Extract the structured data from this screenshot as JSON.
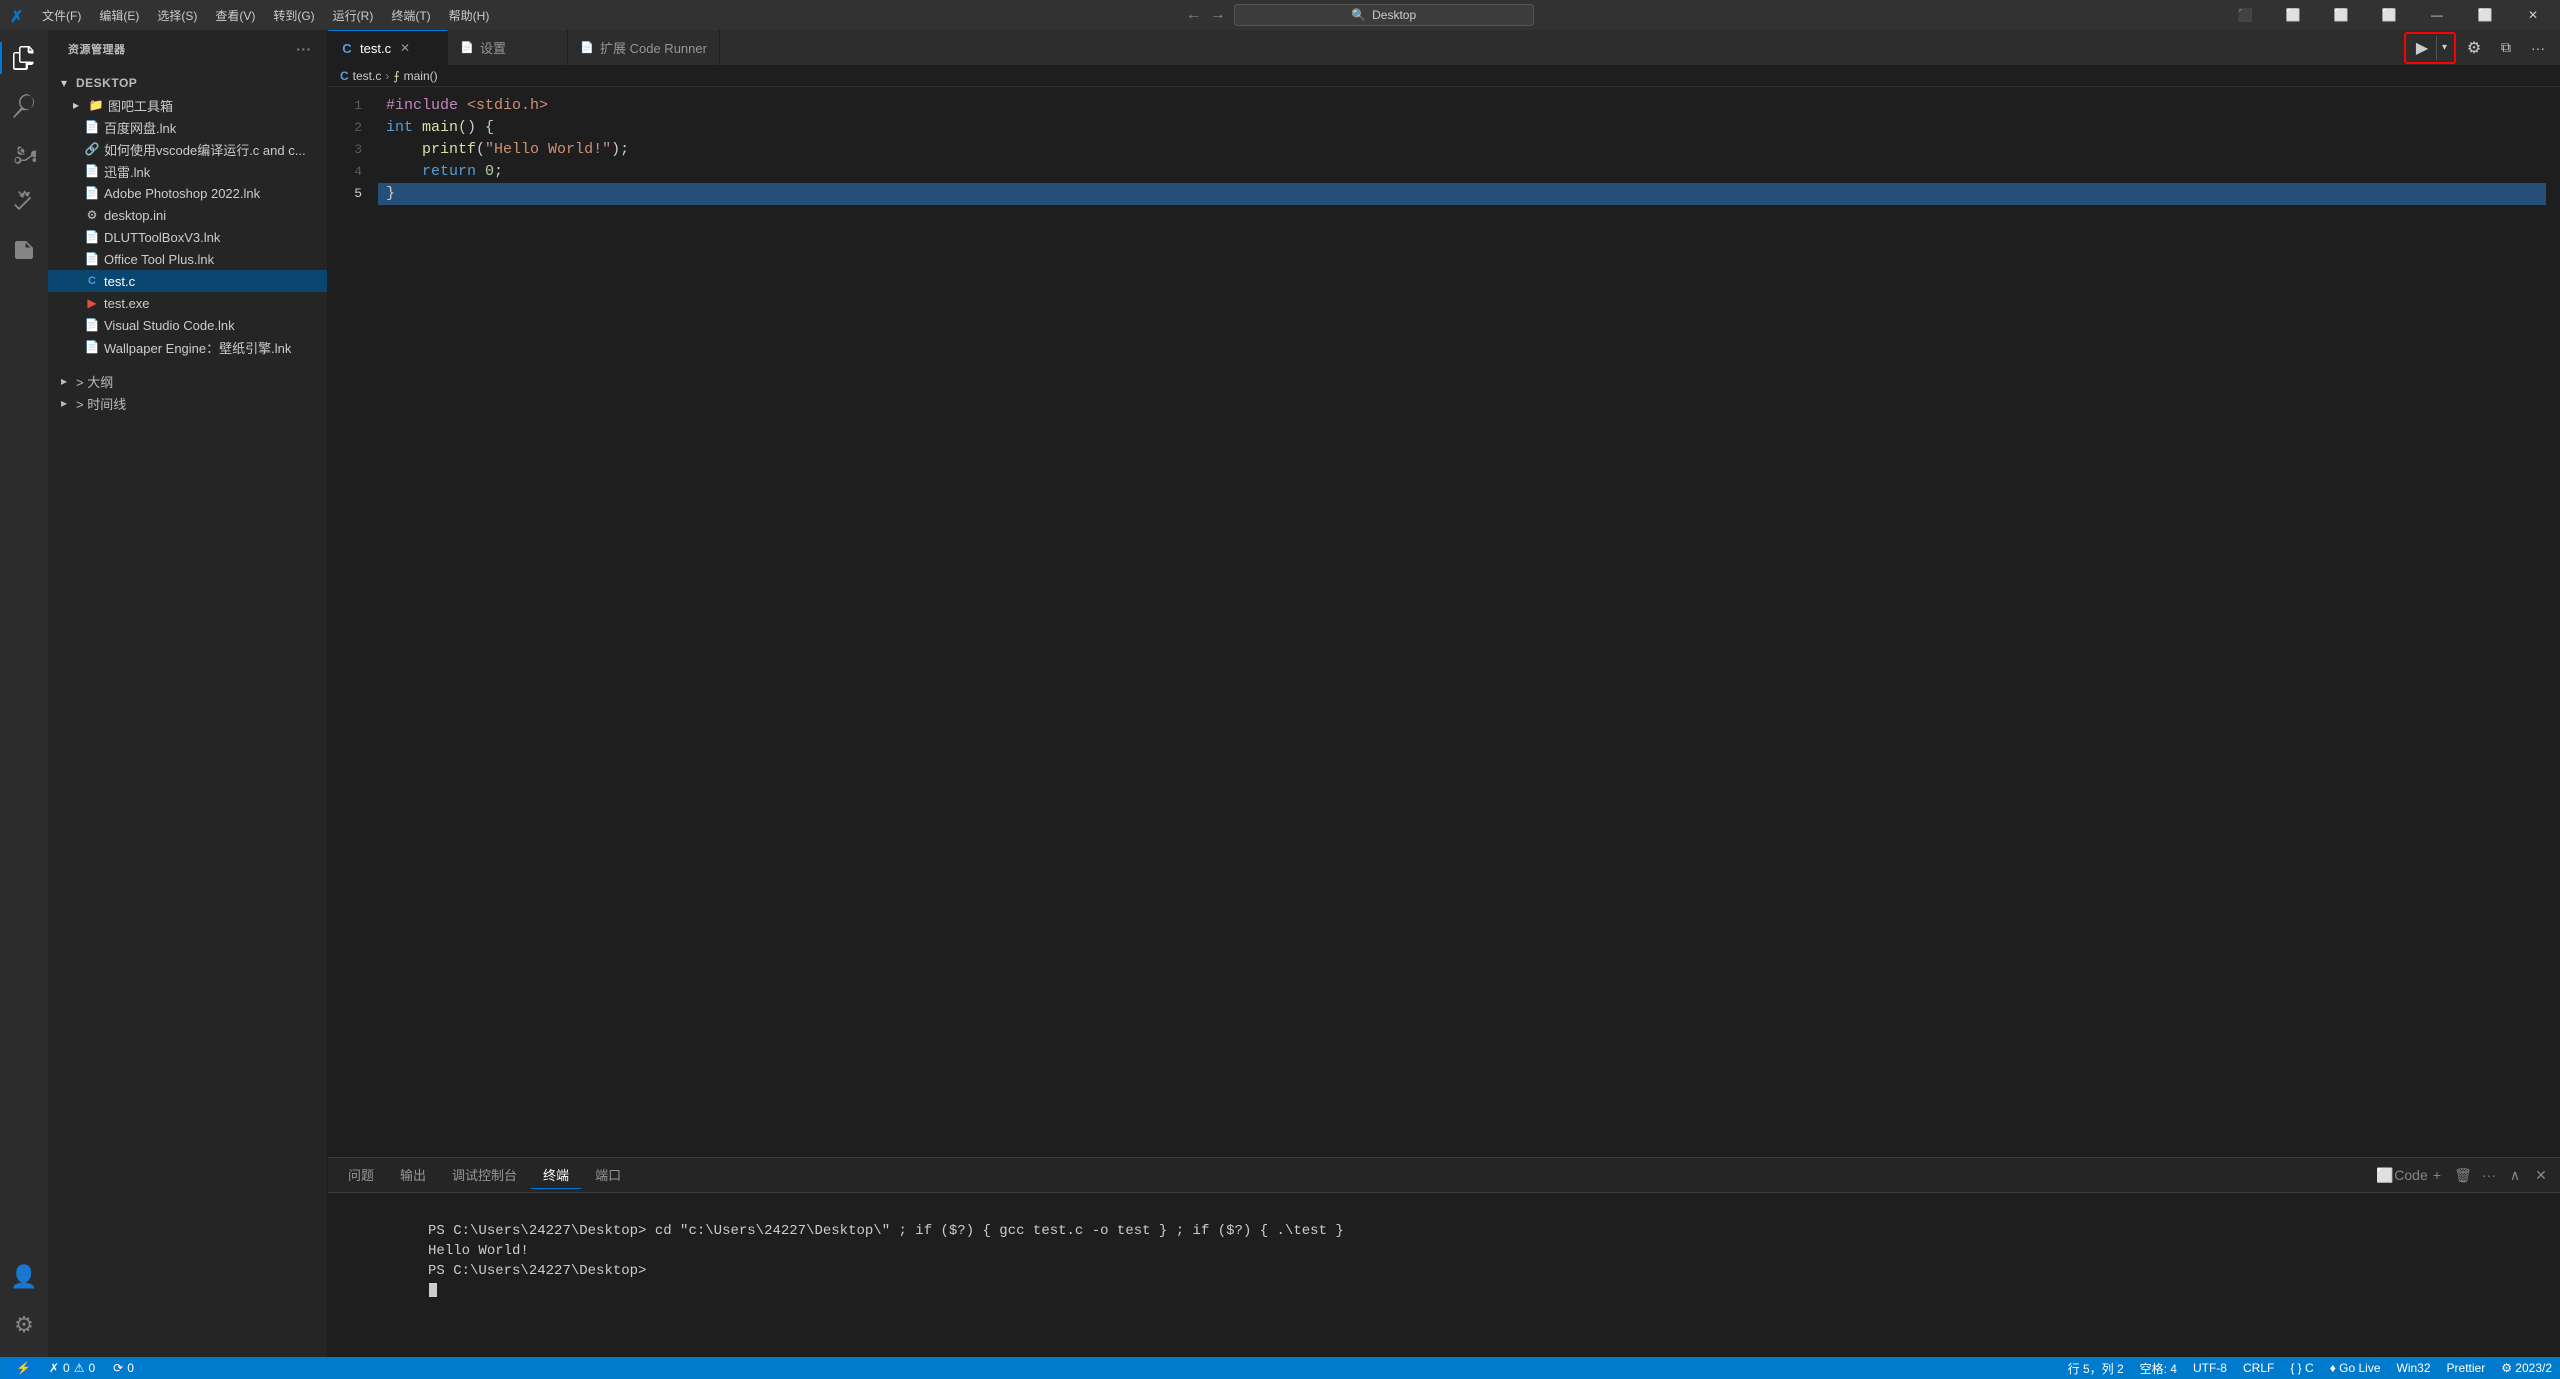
{
  "titleBar": {
    "logo": "✗",
    "menus": [
      "文件(F)",
      "编辑(E)",
      "选择(S)",
      "查看(V)",
      "转到(G)",
      "运行(R)",
      "终端(T)",
      "帮助(H)"
    ],
    "search": "Desktop",
    "nav": {
      "back": "←",
      "forward": "→"
    },
    "windowControls": {
      "sidebar": "⬜",
      "panel": "⬜",
      "split": "⬜",
      "layout": "⬜",
      "minimize": "—",
      "maximize": "⬜",
      "close": "✕"
    }
  },
  "activityBar": {
    "icons": [
      {
        "name": "explorer-icon",
        "glyph": "⎘",
        "active": true
      },
      {
        "name": "search-icon",
        "glyph": "🔍",
        "active": false
      },
      {
        "name": "source-control-icon",
        "glyph": "⑂",
        "active": false
      },
      {
        "name": "debug-icon",
        "glyph": "▶",
        "active": false
      },
      {
        "name": "extensions-icon",
        "glyph": "⊞",
        "active": false
      }
    ],
    "bottom": [
      {
        "name": "account-icon",
        "glyph": "👤"
      },
      {
        "name": "settings-icon",
        "glyph": "⚙"
      }
    ]
  },
  "sidebar": {
    "title": "资源管理器",
    "moreBtn": "···",
    "rootFolder": "DESKTOP",
    "items": [
      {
        "label": "图吧工具箱",
        "type": "folder",
        "depth": 1,
        "expanded": false
      },
      {
        "label": "百度网盘.lnk",
        "type": "file",
        "depth": 2
      },
      {
        "label": "如何使用vscode编译运行.c and c...",
        "type": "file-link",
        "depth": 2
      },
      {
        "label": "迅雷.lnk",
        "type": "file",
        "depth": 2
      },
      {
        "label": "Adobe Photoshop 2022.lnk",
        "type": "file",
        "depth": 2
      },
      {
        "label": "desktop.ini",
        "type": "file-settings",
        "depth": 2
      },
      {
        "label": "DLUTToolBoxV3.lnk",
        "type": "file",
        "depth": 2
      },
      {
        "label": "Office Tool Plus.lnk",
        "type": "file",
        "depth": 2
      },
      {
        "label": "test.c",
        "type": "c-file",
        "depth": 2,
        "active": true
      },
      {
        "label": "test.exe",
        "type": "exe-file",
        "depth": 2
      },
      {
        "label": "Visual Studio Code.lnk",
        "type": "file",
        "depth": 2
      },
      {
        "label": "Wallpaper Engine：壁纸引擎.lnk",
        "type": "file",
        "depth": 2
      }
    ],
    "outlineSection": "> 大纲",
    "timelineSection": "> 时间线"
  },
  "tabs": [
    {
      "label": "test.c",
      "type": "c-file",
      "active": true,
      "hasClose": true
    },
    {
      "label": "设置",
      "type": "settings",
      "active": false,
      "hasClose": false
    },
    {
      "label": "扩展 Code Runner",
      "type": "extension",
      "active": false,
      "hasClose": false
    }
  ],
  "breadcrumb": {
    "items": [
      "test.c",
      "main()"
    ]
  },
  "editor": {
    "lines": [
      {
        "num": 1,
        "tokens": [
          {
            "text": "#include ",
            "class": "inc"
          },
          {
            "text": "<stdio.h>",
            "class": "hdr"
          }
        ]
      },
      {
        "num": 2,
        "tokens": [
          {
            "text": "int ",
            "class": "kw"
          },
          {
            "text": "main",
            "class": "fn"
          },
          {
            "text": "() {",
            "class": "plain"
          }
        ]
      },
      {
        "num": 3,
        "tokens": [
          {
            "text": "    ",
            "class": "plain"
          },
          {
            "text": "printf",
            "class": "fn"
          },
          {
            "text": "(",
            "class": "plain"
          },
          {
            "text": "\"Hello World!\"",
            "class": "str"
          },
          {
            "text": ");",
            "class": "plain"
          }
        ]
      },
      {
        "num": 4,
        "tokens": [
          {
            "text": "    ",
            "class": "plain"
          },
          {
            "text": "return ",
            "class": "kw"
          },
          {
            "text": "0",
            "class": "num"
          },
          {
            "text": ";",
            "class": "plain"
          }
        ]
      },
      {
        "num": 5,
        "tokens": [
          {
            "text": "}",
            "class": "plain"
          }
        ],
        "highlighted": true
      }
    ]
  },
  "toolbar": {
    "runLabel": "▶",
    "splitRunLabel": "⌄",
    "settingsLabel": "⚙",
    "splitEditorLabel": "⧉",
    "moreLabel": "···"
  },
  "panel": {
    "tabs": [
      "问题",
      "输出",
      "调试控制台",
      "终端",
      "端口"
    ],
    "activeTab": "终端",
    "actions": {
      "split": "⬜",
      "codeLabel": "Code",
      "add": "+",
      "trash": "🗑",
      "more": "···",
      "chevronUp": "∧",
      "close": "✕"
    },
    "terminal": {
      "line1": "PS C:\\Users\\24227\\Desktop> cd \"c:\\Users\\24227\\Desktop\\\" ; if ($?) { gcc test.c -o test } ; if ($?) { .\\test }",
      "line2": "Hello World!",
      "line3": "PS C:\\Users\\24227\\Desktop>"
    }
  },
  "statusBar": {
    "errors": "✗ 0",
    "warnings": "⚠ 0",
    "sync": "⟳ 0",
    "line": "行 5，列 2",
    "spaces": "空格: 4",
    "encoding": "UTF-8",
    "lineEnding": "CRLF",
    "language": "{ }",
    "languageMode": "C",
    "goLive": "♦ Go Live",
    "platform": "Win32",
    "prettier": "Prettier",
    "extraInfo": "⚙ 2023/2"
  }
}
